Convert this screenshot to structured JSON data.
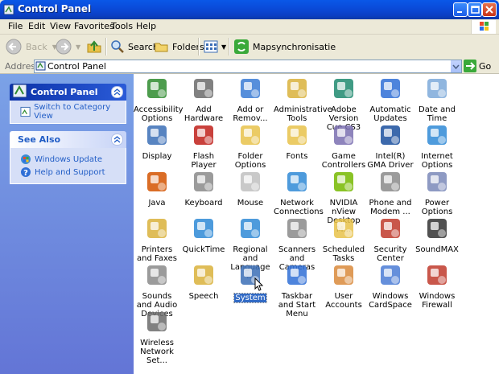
{
  "window": {
    "title": "Control Panel"
  },
  "menu": [
    "File",
    "Edit",
    "View",
    "Favorites",
    "Tools",
    "Help"
  ],
  "toolbar": {
    "back": "Back",
    "search": "Search",
    "folders": "Folders",
    "mapsync": "Mapsynchronisatie"
  },
  "address": {
    "label": "Address",
    "value": "Control Panel",
    "go": "Go"
  },
  "left_pane": {
    "control_panel_box": {
      "title": "Control Panel",
      "task": "Switch to Category View"
    },
    "see_also_box": {
      "title": "See Also",
      "tasks": [
        "Windows Update",
        "Help and Support"
      ]
    }
  },
  "items": [
    {
      "label": "Accessibility Options",
      "icon": "accessibility-icon",
      "color": "#2e8b2e"
    },
    {
      "label": "Add Hardware",
      "icon": "add-hardware-icon",
      "color": "#6b6b6b"
    },
    {
      "label": "Add or Remov...",
      "icon": "add-remove-programs-icon",
      "color": "#3a7bd5"
    },
    {
      "label": "Administrative Tools",
      "icon": "administrative-tools-icon",
      "color": "#d9b13b"
    },
    {
      "label": "Adobe Version Cue CS3",
      "icon": "adobe-version-cue-icon",
      "color": "#1f8a6e"
    },
    {
      "label": "Automatic Updates",
      "icon": "automatic-updates-icon",
      "color": "#2f6fd6"
    },
    {
      "label": "Date and Time",
      "icon": "date-time-icon",
      "color": "#7da9d9"
    },
    {
      "label": "Display",
      "icon": "display-icon",
      "color": "#3b6fb6"
    },
    {
      "label": "Flash Player",
      "icon": "flash-player-icon",
      "color": "#c0201a"
    },
    {
      "label": "Folder Options",
      "icon": "folder-options-icon",
      "color": "#e8c24a"
    },
    {
      "label": "Fonts",
      "icon": "fonts-icon",
      "color": "#e8c24a"
    },
    {
      "label": "Game Controllers",
      "icon": "game-controllers-icon",
      "color": "#7a6fb0"
    },
    {
      "label": "Intel(R) GMA Driver",
      "icon": "intel-gma-icon",
      "color": "#1a4f9e"
    },
    {
      "label": "Internet Options",
      "icon": "internet-options-icon",
      "color": "#2f8ad6"
    },
    {
      "label": "Java",
      "icon": "java-icon",
      "color": "#d35400"
    },
    {
      "label": "Keyboard",
      "icon": "keyboard-icon",
      "color": "#8a8a8a"
    },
    {
      "label": "Mouse",
      "icon": "mouse-icon",
      "color": "#bfbfbf"
    },
    {
      "label": "Network Connections",
      "icon": "network-connections-icon",
      "color": "#2f8ad6"
    },
    {
      "label": "NVIDIA nView Desktop M...",
      "icon": "nvidia-nview-icon",
      "color": "#76b900"
    },
    {
      "label": "Phone and Modem ...",
      "icon": "phone-modem-icon",
      "color": "#8a8a8a"
    },
    {
      "label": "Power Options",
      "icon": "power-options-icon",
      "color": "#7a88b8"
    },
    {
      "label": "Printers and Faxes",
      "icon": "printers-faxes-icon",
      "color": "#d9b13b"
    },
    {
      "label": "QuickTime",
      "icon": "quicktime-icon",
      "color": "#2e8ad6"
    },
    {
      "label": "Regional and Language ...",
      "icon": "regional-language-icon",
      "color": "#2f8ad6"
    },
    {
      "label": "Scanners and Cameras",
      "icon": "scanners-cameras-icon",
      "color": "#8a8a8a"
    },
    {
      "label": "Scheduled Tasks",
      "icon": "scheduled-tasks-icon",
      "color": "#e8c24a"
    },
    {
      "label": "Security Center",
      "icon": "security-center-icon",
      "color": "#c0392b"
    },
    {
      "label": "SoundMAX",
      "icon": "soundmax-icon",
      "color": "#333333"
    },
    {
      "label": "Sounds and Audio Devices",
      "icon": "sounds-audio-icon",
      "color": "#8a8a8a"
    },
    {
      "label": "Speech",
      "icon": "speech-icon",
      "color": "#d9b13b"
    },
    {
      "label": "System",
      "icon": "system-icon",
      "color": "#3b6fb6",
      "selected": true
    },
    {
      "label": "Taskbar and Start Menu",
      "icon": "taskbar-start-menu-icon",
      "color": "#2f6fd6"
    },
    {
      "label": "User Accounts",
      "icon": "user-accounts-icon",
      "color": "#d98a3b"
    },
    {
      "label": "Windows CardSpace",
      "icon": "windows-cardspace-icon",
      "color": "#4a7bd5"
    },
    {
      "label": "Windows Firewall",
      "icon": "windows-firewall-icon",
      "color": "#c0392b"
    },
    {
      "label": "Wireless Network Set...",
      "icon": "wireless-network-icon",
      "color": "#6b6b6b"
    }
  ]
}
